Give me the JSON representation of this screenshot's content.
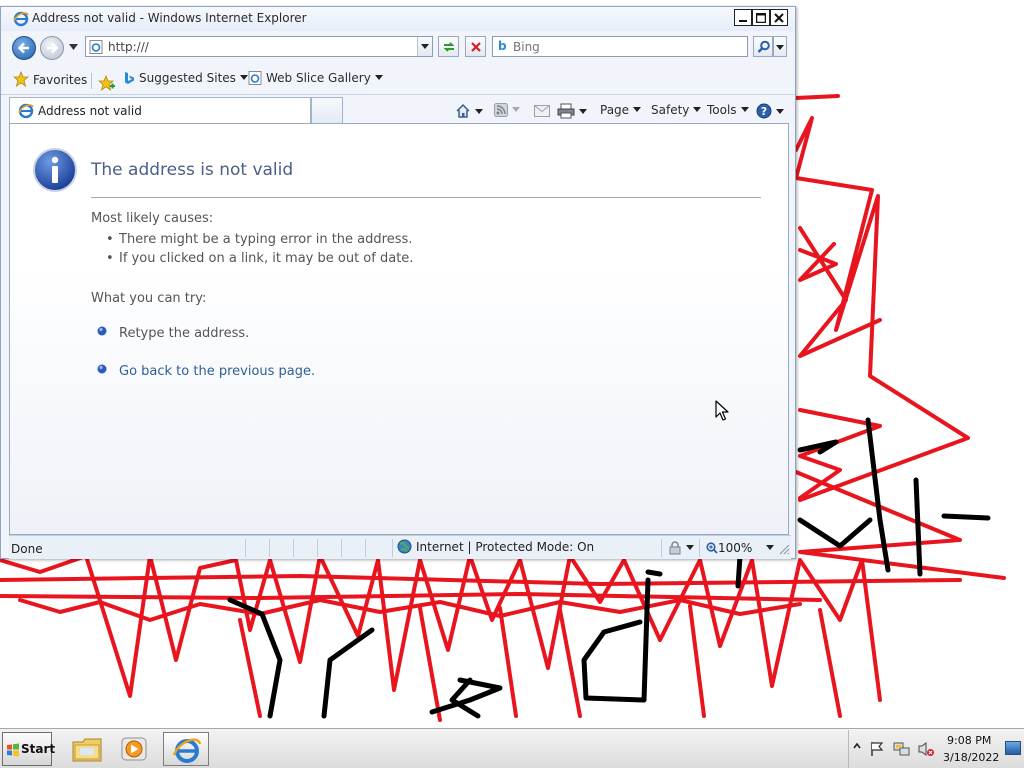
{
  "window": {
    "title": "Address not valid - Windows Internet Explorer",
    "buttons": [
      "minimize",
      "maximize",
      "close"
    ]
  },
  "navigation": {
    "address_value": "http:///",
    "search_placeholder": "Bing"
  },
  "favorites_bar": {
    "favorites_label": "Favorites",
    "items": [
      "Suggested Sites",
      "Web Slice Gallery"
    ]
  },
  "tab": {
    "title": "Address not valid"
  },
  "command_bar": {
    "page_label": "Page",
    "safety_label": "Safety",
    "tools_label": "Tools"
  },
  "error_page": {
    "title": "The address is not valid",
    "causes_heading": "Most likely causes:",
    "causes": [
      "There might be a typing error in the address.",
      "If you clicked on a link, it may be out of date."
    ],
    "try_heading": "What you can try:",
    "try_items": [
      "Retype the address.",
      "Go back to the previous page."
    ]
  },
  "status_bar": {
    "status_text": "Done",
    "zone_text": "Internet | Protected Mode: On",
    "zoom": "100%"
  },
  "taskbar": {
    "start_label": "Start",
    "apps": [
      "windows-explorer-icon",
      "media-player-icon",
      "internet-explorer-icon"
    ],
    "clock_time": "9:08 PM",
    "clock_date": "3/18/2022"
  },
  "colors": {
    "scribble_red": "#e8141e",
    "scribble_black": "#000000",
    "link_blue": "#2f5f96",
    "error_title": "#4a5f86"
  }
}
